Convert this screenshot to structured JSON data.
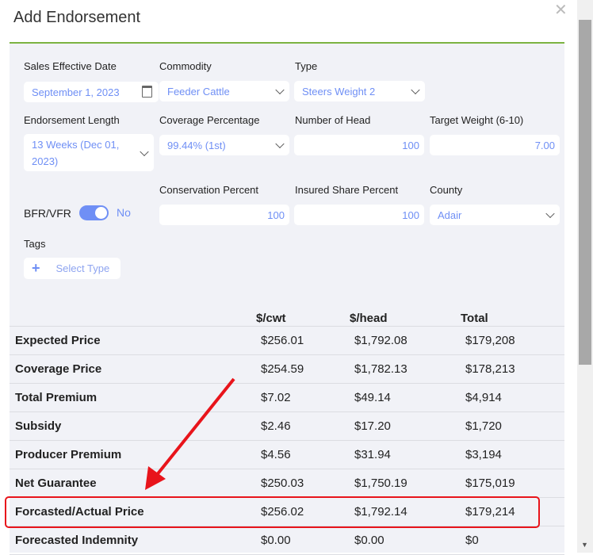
{
  "title": "Add Endorsement",
  "form": {
    "sales_effective_date": {
      "label": "Sales Effective Date",
      "value": "September 1, 2023"
    },
    "commodity": {
      "label": "Commodity",
      "value": "Feeder Cattle"
    },
    "type": {
      "label": "Type",
      "value": "Steers Weight 2"
    },
    "endorsement_length": {
      "label": "Endorsement Length",
      "value_line1": "13 Weeks (Dec 01,",
      "value_line2": "2023)"
    },
    "coverage_percentage": {
      "label": "Coverage Percentage",
      "value": "99.44% (1st)"
    },
    "number_of_head": {
      "label": "Number of Head",
      "value": "100"
    },
    "target_weight": {
      "label": "Target Weight (6-10)",
      "value": "7.00"
    },
    "bfr_vfr": {
      "label": "BFR/VFR",
      "value": "No"
    },
    "conservation_percent": {
      "label": "Conservation Percent",
      "value": "100"
    },
    "insured_share_percent": {
      "label": "Insured Share Percent",
      "value": "100"
    },
    "county": {
      "label": "County",
      "value": "Adair"
    },
    "tags": {
      "label": "Tags",
      "placeholder": "Select Type"
    }
  },
  "table": {
    "headers": [
      "",
      "$/cwt",
      "$/head",
      "Total"
    ],
    "rows": [
      [
        "Expected Price",
        "$256.01",
        "$1,792.08",
        "$179,208"
      ],
      [
        "Coverage Price",
        "$254.59",
        "$1,782.13",
        "$178,213"
      ],
      [
        "Total Premium",
        "$7.02",
        "$49.14",
        "$4,914"
      ],
      [
        "Subsidy",
        "$2.46",
        "$17.20",
        "$1,720"
      ],
      [
        "Producer Premium",
        "$4.56",
        "$31.94",
        "$3,194"
      ],
      [
        "Net Guarantee",
        "$250.03",
        "$1,750.19",
        "$175,019"
      ],
      [
        "Forcasted/Actual Price",
        "$256.02",
        "$1,792.14",
        "$179,214"
      ],
      [
        "Forecasted Indemnity",
        "$0.00",
        "$0.00",
        "$0"
      ]
    ]
  },
  "colors": {
    "accent": "#6f8ff5",
    "divider": "#7cb342",
    "highlight": "#e8141b"
  }
}
